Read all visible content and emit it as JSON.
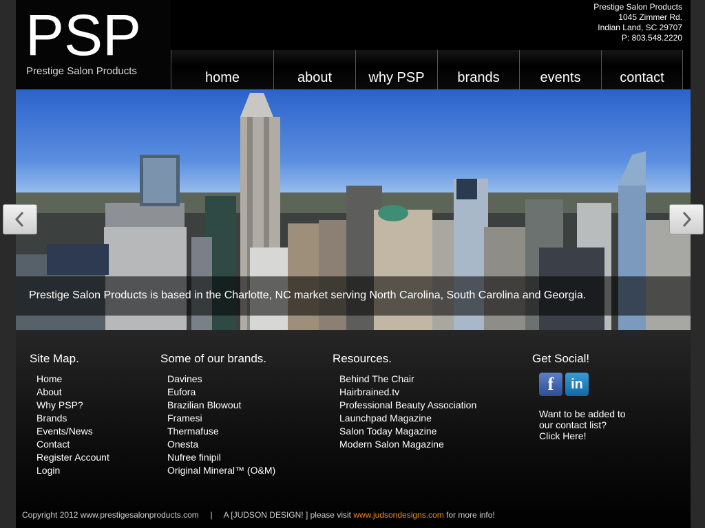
{
  "header": {
    "logo_text": "PSP",
    "logo_subtitle": "Prestige Salon Products",
    "address": {
      "name": "Prestige Salon Products",
      "street": "1045 Zimmer Rd.",
      "city": "Indian Land, SC 29707",
      "phone": "P: 803.548.2220"
    },
    "nav": [
      "home",
      "about",
      "why PSP",
      "brands",
      "events",
      "contact"
    ]
  },
  "slider": {
    "caption": "Prestige Salon Products is based in the Charlotte, NC market serving North Carolina, South Carolina and Georgia.",
    "slide_count": 8,
    "active_slide": 1
  },
  "footer": {
    "sitemap": {
      "title": "Site Map.",
      "links": [
        "Home",
        "About",
        "Why PSP?",
        "Brands",
        "Events/News",
        "Contact",
        "Register Account",
        "Login"
      ]
    },
    "brands": {
      "title": "Some of our brands.",
      "links": [
        "Davines",
        "Eufora",
        "Brazilian Blowout",
        "Framesi",
        "Thermafuse",
        "Onesta",
        "Nufree finipil",
        "Original Mineral™ (O&M)"
      ]
    },
    "resources": {
      "title": "Resources.",
      "links": [
        "Behind The Chair",
        "Hairbrained.tv",
        "Professional Beauty Association",
        "Launchpad Magazine",
        "Salon Today Magazine",
        "Modern Salon Magazine"
      ]
    },
    "social": {
      "title": "Get Social!",
      "icons": [
        "facebook-icon",
        "linkedin-icon"
      ],
      "contact_line1": "Want to be added to",
      "contact_line2": "our contact list?",
      "contact_link": "Click Here!"
    },
    "copyright_pre": "Copyright 2012 www.prestigesalonproducts.com     |     A [JUDSON DESIGN! ] please visit ",
    "copyright_link": "www.judsondesigns.com",
    "copyright_post": " for more info!"
  }
}
